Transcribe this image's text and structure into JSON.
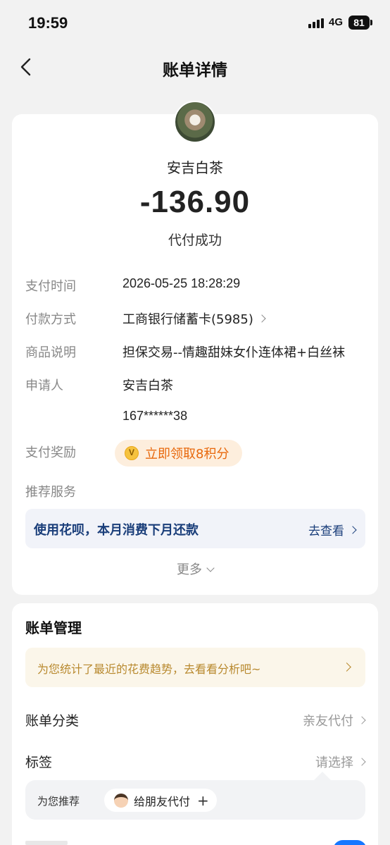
{
  "status_bar": {
    "time": "19:59",
    "network": "4G",
    "battery": "81"
  },
  "nav": {
    "title": "账单详情"
  },
  "payment": {
    "payee": "安吉白茶",
    "amount": "-136.90",
    "status": "代付成功"
  },
  "details": [
    {
      "label": "支付时间",
      "value": "2026-05-25  18:28:29"
    },
    {
      "label": "付款方式",
      "value": "工商银行储蓄卡(5985)"
    },
    {
      "label": "商品说明",
      "value": "担保交易--情趣甜妹女仆连体裙+白丝袜"
    },
    {
      "label": "申请人",
      "value": "安吉白茶"
    },
    {
      "label": "",
      "value": "167******38"
    }
  ],
  "reward": {
    "label": "支付奖励",
    "text": "立即领取8积分",
    "icon_text": "V"
  },
  "recommend": {
    "label": "推荐服务",
    "promo_text": "使用花呗，本月消费下月还款",
    "promo_link": "去查看"
  },
  "more": "更多",
  "management": {
    "title": "账单管理",
    "trend_text": "为您统计了最近的花费趋势，去看看分析吧~",
    "category_label": "账单分类",
    "category_value": "亲友代付",
    "tag_label": "标签",
    "tag_value": "请选择",
    "rec_label": "为您推荐",
    "rec_chip": "给朋友代付",
    "rec_plus": "+"
  },
  "colors": {
    "accent_blue": "#1a3e7a",
    "reward_orange": "#e8680c",
    "trend_gold": "#b8892e",
    "toggle_blue": "#1677ff"
  }
}
